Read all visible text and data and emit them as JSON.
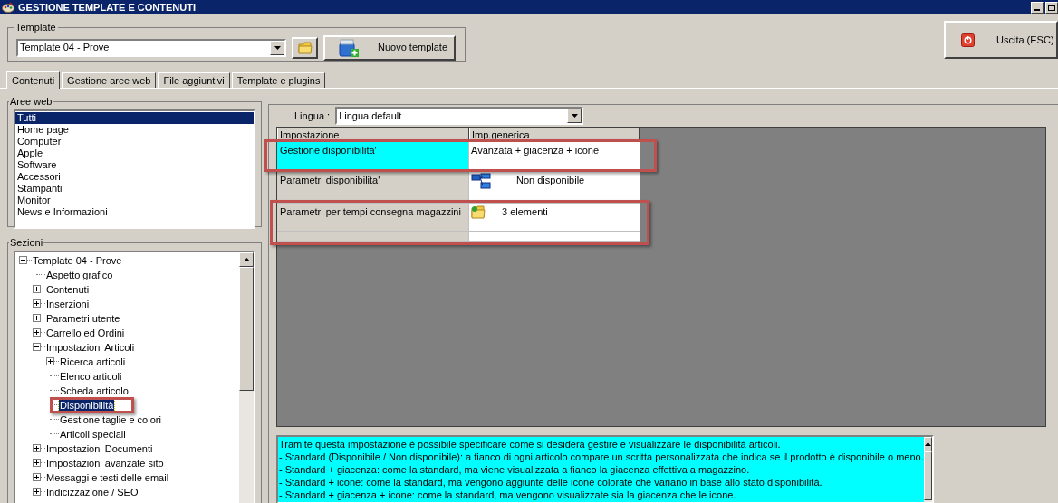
{
  "window": {
    "title": "GESTIONE TEMPLATE E CONTENUTI"
  },
  "template_group": {
    "label": "Template",
    "value": "Template 04 - Prove",
    "new_button": "Nuovo template"
  },
  "exit_button": "Uscita (ESC)",
  "tabs": [
    {
      "label": "Contenuti",
      "selected": true
    },
    {
      "label": "Gestione aree web",
      "selected": false
    },
    {
      "label": "File aggiuntivi",
      "selected": false
    },
    {
      "label": "Template e plugins",
      "selected": false
    }
  ],
  "web_areas": {
    "label": "Aree web",
    "items": [
      {
        "label": "Tutti",
        "selected": true
      },
      {
        "label": "Home page",
        "selected": false
      },
      {
        "label": "Computer",
        "selected": false
      },
      {
        "label": "Apple",
        "selected": false
      },
      {
        "label": "Software",
        "selected": false
      },
      {
        "label": "Accessori",
        "selected": false
      },
      {
        "label": "Stampanti",
        "selected": false
      },
      {
        "label": "Monitor",
        "selected": false
      },
      {
        "label": "News e Informazioni",
        "selected": false
      }
    ]
  },
  "sections": {
    "label": "Sezioni",
    "tree": [
      {
        "label": "Template 04 - Prove",
        "expanded": true,
        "selected": false,
        "annotated": false,
        "children": [
          {
            "label": "Aspetto grafico",
            "selected": false,
            "annotated": false
          },
          {
            "label": "Contenuti",
            "expanded": false,
            "selected": false,
            "annotated": false
          },
          {
            "label": "Inserzioni",
            "expanded": false,
            "selected": false,
            "annotated": false
          },
          {
            "label": "Parametri utente",
            "expanded": false,
            "selected": false,
            "annotated": false
          },
          {
            "label": "Carrello ed Ordini",
            "expanded": false,
            "selected": false,
            "annotated": false
          },
          {
            "label": "Impostazioni Articoli",
            "expanded": true,
            "selected": false,
            "annotated": false,
            "children": [
              {
                "label": "Ricerca articoli",
                "expanded": false,
                "selected": false,
                "annotated": false
              },
              {
                "label": "Elenco articoli",
                "selected": false,
                "annotated": false
              },
              {
                "label": "Scheda articolo",
                "selected": false,
                "annotated": false
              },
              {
                "label": "Disponibilità",
                "selected": true,
                "annotated": true
              },
              {
                "label": "Gestione taglie e colori",
                "selected": false,
                "annotated": false
              },
              {
                "label": "Articoli speciali",
                "selected": false,
                "annotated": false
              }
            ]
          },
          {
            "label": "Impostazioni Documenti",
            "expanded": false,
            "selected": false,
            "annotated": false
          },
          {
            "label": "Impostazioni avanzate sito",
            "expanded": false,
            "selected": false,
            "annotated": false
          },
          {
            "label": "Messaggi e testi delle email",
            "expanded": false,
            "selected": false,
            "annotated": false
          },
          {
            "label": "Indicizzazione / SEO",
            "expanded": false,
            "selected": false,
            "annotated": false
          }
        ]
      }
    ]
  },
  "language": {
    "label": "Lingua :",
    "value": "Lingua default"
  },
  "grid": {
    "columns": [
      "Impostazione",
      "Imp.generica"
    ],
    "rows": [
      {
        "setting": "Gestione disponibilita'",
        "value": "Avanzata + giacenza + icone",
        "kind": "text",
        "selected": true,
        "annotated": true
      },
      {
        "setting": "Parametri disponibilita'",
        "value": "Non disponibile",
        "kind": "link",
        "selected": false,
        "annotated": false
      },
      {
        "setting": "Parametri per tempi consegna magazzini",
        "value": "3 elementi",
        "kind": "folder",
        "selected": false,
        "annotated": true
      }
    ]
  },
  "description": [
    "Tramite questa impostazione è possibile specificare come si desidera gestire e visualizzare le disponibilità articoli.",
    "- Standard (Disponibile / Non disponibile): a fianco di ogni articolo compare un scritta personalizzata che indica se il prodotto è disponibile o meno.",
    "- Standard + giacenza: come la standard, ma viene visualizzata a fianco la giacenza effettiva a magazzino.",
    "- Standard + icone: come la standard, ma vengono aggiunte delle icone colorate che variano in base allo stato disponibilità.",
    "- Standard + giacenza + icone: come la standard, ma vengono visualizzate sia la giacenza che le icone."
  ]
}
